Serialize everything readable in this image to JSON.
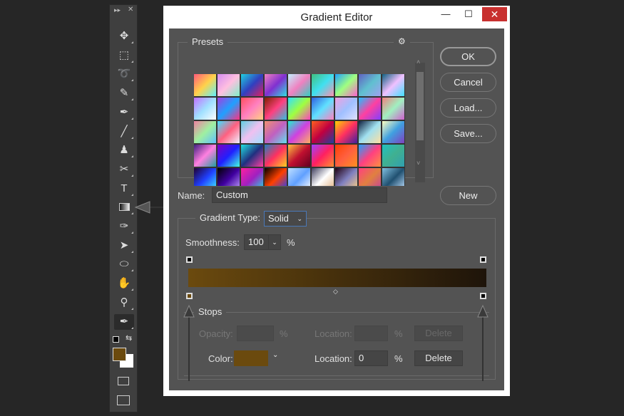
{
  "toolbar": {
    "tools": [
      "move",
      "marquee",
      "lasso",
      "quick-select",
      "eyedropper",
      "brush",
      "stamp",
      "eraser",
      "type",
      "gradient",
      "pen",
      "path-select",
      "ellipse",
      "hand",
      "zoom",
      "color-sampler"
    ],
    "foreground_color": "#6b4a0e",
    "background_color": "#ffffff"
  },
  "dialog": {
    "title": "Gradient Editor",
    "minimize": "—",
    "maximize": "☐",
    "close": "✕",
    "presets_label": "Presets",
    "gear": "⚙",
    "buttons": {
      "ok": "OK",
      "cancel": "Cancel",
      "load": "Load...",
      "save": "Save...",
      "new": "New"
    },
    "name_label": "Name:",
    "name_value": "Custom",
    "gradient_type_label": "Gradient Type:",
    "gradient_type_value": "Solid",
    "smoothness_label": "Smoothness:",
    "smoothness_value": "100",
    "percent": "%",
    "gradient": {
      "start_color": "#6b4a0e",
      "end_color": "#1e140a"
    },
    "stops": {
      "label": "Stops",
      "opacity_label": "Opacity:",
      "opacity_value": "",
      "location_label": "Location:",
      "opacity_location_value": "",
      "delete": "Delete",
      "color_label": "Color:",
      "color_value": "#6b4a0e",
      "color_location_value": "0"
    }
  },
  "preset_colors": [
    [
      "#ff5a7a",
      "#ffd24a",
      "#5ef0ff"
    ],
    [
      "#d48cf0",
      "#ffc0e0",
      "#7ef0c8"
    ],
    [
      "#20d0e0",
      "#3040c0",
      "#e02060"
    ],
    [
      "#f080c0",
      "#8030d0",
      "#30e0e0"
    ],
    [
      "#c0f0ff",
      "#f080c0",
      "#30d0c0"
    ],
    [
      "#40c080",
      "#40e0f0",
      "#ff90b0"
    ],
    [
      "#20a0ff",
      "#a0ff80",
      "#ff60d0"
    ],
    [
      "#6060c0",
      "#60c0d0",
      "#a0a0f0"
    ],
    [
      "#106080",
      "#f0c0ff",
      "#40e0ff"
    ],
    [
      "#c070ff",
      "#a0e0ff",
      "#ffffff"
    ],
    [
      "#a040e0",
      "#20a0ff",
      "#ff3080"
    ],
    [
      "#ff5060",
      "#ff80c0",
      "#ffd080"
    ],
    [
      "#802000",
      "#ff4080",
      "#30c0e0"
    ],
    [
      "#30e0ff",
      "#a0ff40",
      "#ff40c0"
    ],
    [
      "#3060e0",
      "#60e0ff",
      "#ff80c0"
    ],
    [
      "#f0a0e0",
      "#a0c0ff",
      "#e0e0ff"
    ],
    [
      "#20c0ff",
      "#ff40a0",
      "#8040ff"
    ],
    [
      "#f08080",
      "#a0f0c0",
      "#d060d0"
    ],
    [
      "#f080a0",
      "#a0f0a0",
      "#60c0ff"
    ],
    [
      "#40e0ff",
      "#ff6080",
      "#f0f0ff"
    ],
    [
      "#60d0e0",
      "#f0c0f0",
      "#a0e0ff"
    ],
    [
      "#f09070",
      "#c060c0",
      "#60e0f0"
    ],
    [
      "#20f0d0",
      "#d040e0",
      "#ffb060"
    ],
    [
      "#ff6020",
      "#c00040",
      "#2040a0"
    ],
    [
      "#ffd000",
      "#ff3060",
      "#4020a0"
    ],
    [
      "#102040",
      "#a0e0f0",
      "#ffe0a0"
    ],
    [
      "#ffffc0",
      "#40a0e0",
      "#8040c0"
    ],
    [
      "#402080",
      "#ff80e0",
      "#20a0a0"
    ],
    [
      "#8000c0",
      "#2020ff",
      "#40ffe0"
    ],
    [
      "#20e0e0",
      "#203080",
      "#ff40a0"
    ],
    [
      "#2080c0",
      "#ff3060",
      "#ffd020"
    ],
    [
      "#ffc040",
      "#c01030",
      "#600020"
    ],
    [
      "#a040ff",
      "#ff2060",
      "#ff9030"
    ],
    [
      "#ff4000",
      "#ff6040",
      "#ff9020"
    ],
    [
      "#20a0ff",
      "#ff4080",
      "#ff9040"
    ],
    [
      "#20c0c0",
      "#40b090",
      "#30a0b0"
    ],
    [
      "#200030",
      "#2040ff",
      "#40f0ff"
    ],
    [
      "#000000",
      "#4000a0",
      "#c0a0ff"
    ],
    [
      "#ff20a0",
      "#a020c0",
      "#20e0e0"
    ],
    [
      "#000000",
      "#ff4000",
      "#2040ff"
    ],
    [
      "#c0e0ff",
      "#60a0ff",
      "#ffffff"
    ],
    [
      "#404060",
      "#ffffff",
      "#e0b080"
    ],
    [
      "#200010",
      "#8080c0",
      "#ffd080"
    ],
    [
      "#ff4080",
      "#e08040",
      "#c040a0"
    ],
    [
      "#80c0e0",
      "#205070",
      "#c0e0ff"
    ]
  ]
}
